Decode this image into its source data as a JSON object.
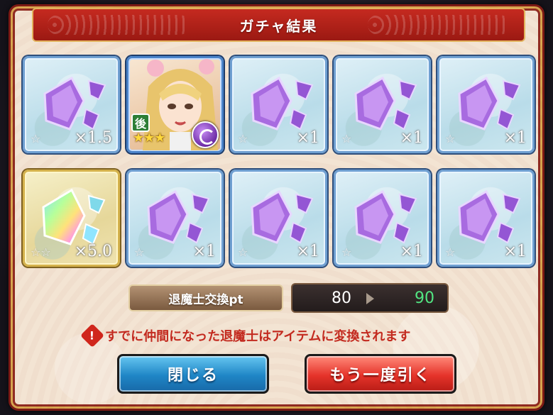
{
  "title": "ガチャ結果",
  "results": [
    {
      "type": "crystal",
      "count": "×1.5",
      "frame": "blue"
    },
    {
      "type": "character",
      "badge": "後",
      "stars": "★★★",
      "frame": "blue"
    },
    {
      "type": "crystal",
      "count": "×1",
      "frame": "blue"
    },
    {
      "type": "crystal",
      "count": "×1",
      "frame": "blue"
    },
    {
      "type": "crystal",
      "count": "×1",
      "frame": "blue"
    },
    {
      "type": "rainbow-crystal",
      "count": "×5.0",
      "frame": "gold"
    },
    {
      "type": "crystal",
      "count": "×1",
      "frame": "blue"
    },
    {
      "type": "crystal",
      "count": "×1",
      "frame": "blue"
    },
    {
      "type": "crystal",
      "count": "×1",
      "frame": "blue"
    },
    {
      "type": "crystal",
      "count": "×1",
      "frame": "blue"
    }
  ],
  "points": {
    "label": "退魔士交換pt",
    "old": "80",
    "new": "90"
  },
  "notice": "すでに仲間になった退魔士はアイテムに変換されます",
  "buttons": {
    "close": "閉じる",
    "again": "もう一度引く"
  },
  "colors": {
    "title_bar": "#b7211a",
    "panel": "#f3e3d2",
    "close_button": "#1f86c6",
    "again_button": "#e5332a",
    "new_points": "#52e582"
  },
  "icons": {
    "warning": "exclamation-warning-icon",
    "arrow": "triangle-right-icon",
    "orb": "purple-element-orb-icon"
  }
}
